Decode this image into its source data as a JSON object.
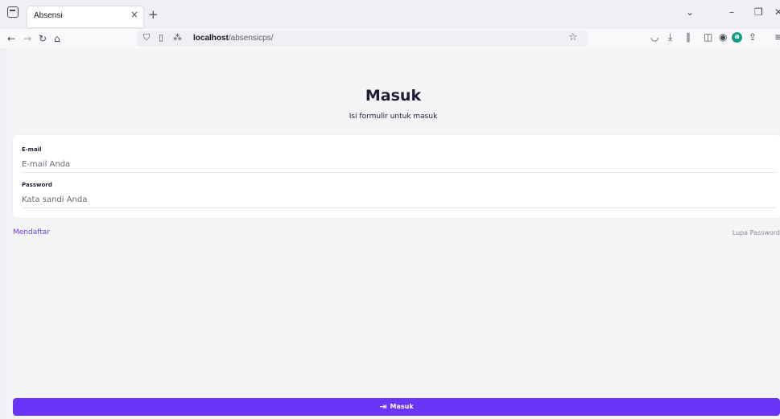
{
  "browser": {
    "tab_title": "Absensi",
    "tab_close": "×",
    "new_tab": "+",
    "url_host": "localhost",
    "url_path": "/absensicps/",
    "icons": [
      "tab-list-icon",
      "back-icon",
      "forward-icon",
      "reload-icon",
      "home-icon",
      "shield-icon",
      "page-icon",
      "permissions-icon",
      "bookmark-star-icon",
      "pocket-icon",
      "download-icon",
      "library-icon",
      "sidebar-icon",
      "account-icon",
      "extension-icon",
      "share-icon"
    ]
  },
  "page": {
    "title": "Masuk",
    "subtitle": "Isi formulir untuk masuk",
    "email_label": "E-mail",
    "email_placeholder": "E-mail Anda",
    "password_label": "Password",
    "password_placeholder": "Kata sandi Anda",
    "register_link": "Mendaftar",
    "forgot_link": "Lupa Password",
    "submit_label": "Masuk"
  },
  "colors": {
    "accent": "#6b35f7",
    "link": "#6a3cf5",
    "text": "#1f1d33"
  }
}
